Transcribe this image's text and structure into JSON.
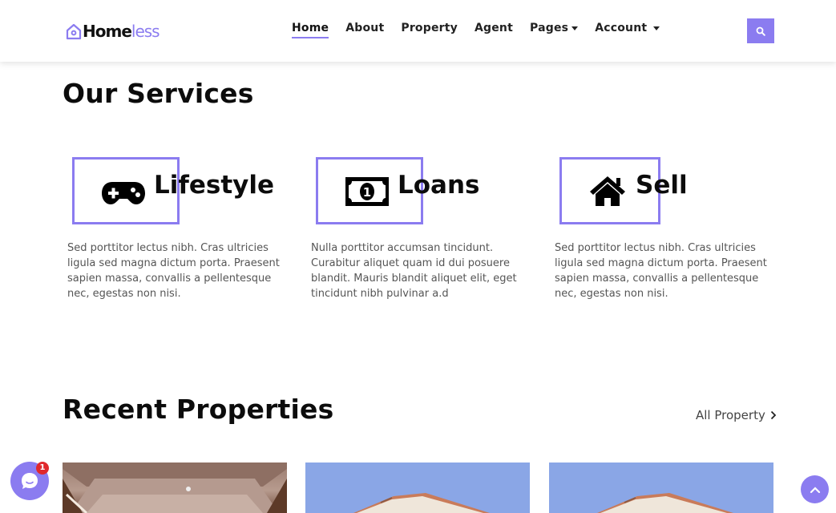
{
  "brand": {
    "logo_dark": "Home",
    "logo_light": "less"
  },
  "nav": {
    "items": [
      {
        "label": "Home"
      },
      {
        "label": "About"
      },
      {
        "label": "Property"
      },
      {
        "label": "Agent"
      },
      {
        "label": "Pages"
      },
      {
        "label": "Account"
      }
    ],
    "active": "Home",
    "search_icon": "search-icon"
  },
  "services": {
    "title": "Our Services",
    "items": [
      {
        "label": "Lifestyle",
        "icon": "gamepad-icon",
        "desc": "Sed porttitor lectus nibh. Cras ultricies ligula sed magna dictum porta. Praesent sapien massa, convallis a pellentesque nec, egestas non nisi."
      },
      {
        "label": "Loans",
        "icon": "money-bill-icon",
        "desc": "Nulla porttitor accumsan tincidunt. Curabitur aliquet quam id dui posuere blandit. Mauris blandit aliquet elit, eget tincidunt nibh pulvinar a.d"
      },
      {
        "label": "Sell",
        "icon": "house-icon",
        "desc": "Sed porttitor lectus nibh. Cras ultricies ligula sed magna dictum porta. Praesent sapien massa, convallis a pellentesque nec, egestas non nisi."
      }
    ]
  },
  "recent": {
    "title": "Recent Properties",
    "all_link": "All Property"
  },
  "chat": {
    "badge_count": "1"
  },
  "colors": {
    "accent": "#8b7cf0",
    "badge": "#e0282c"
  }
}
